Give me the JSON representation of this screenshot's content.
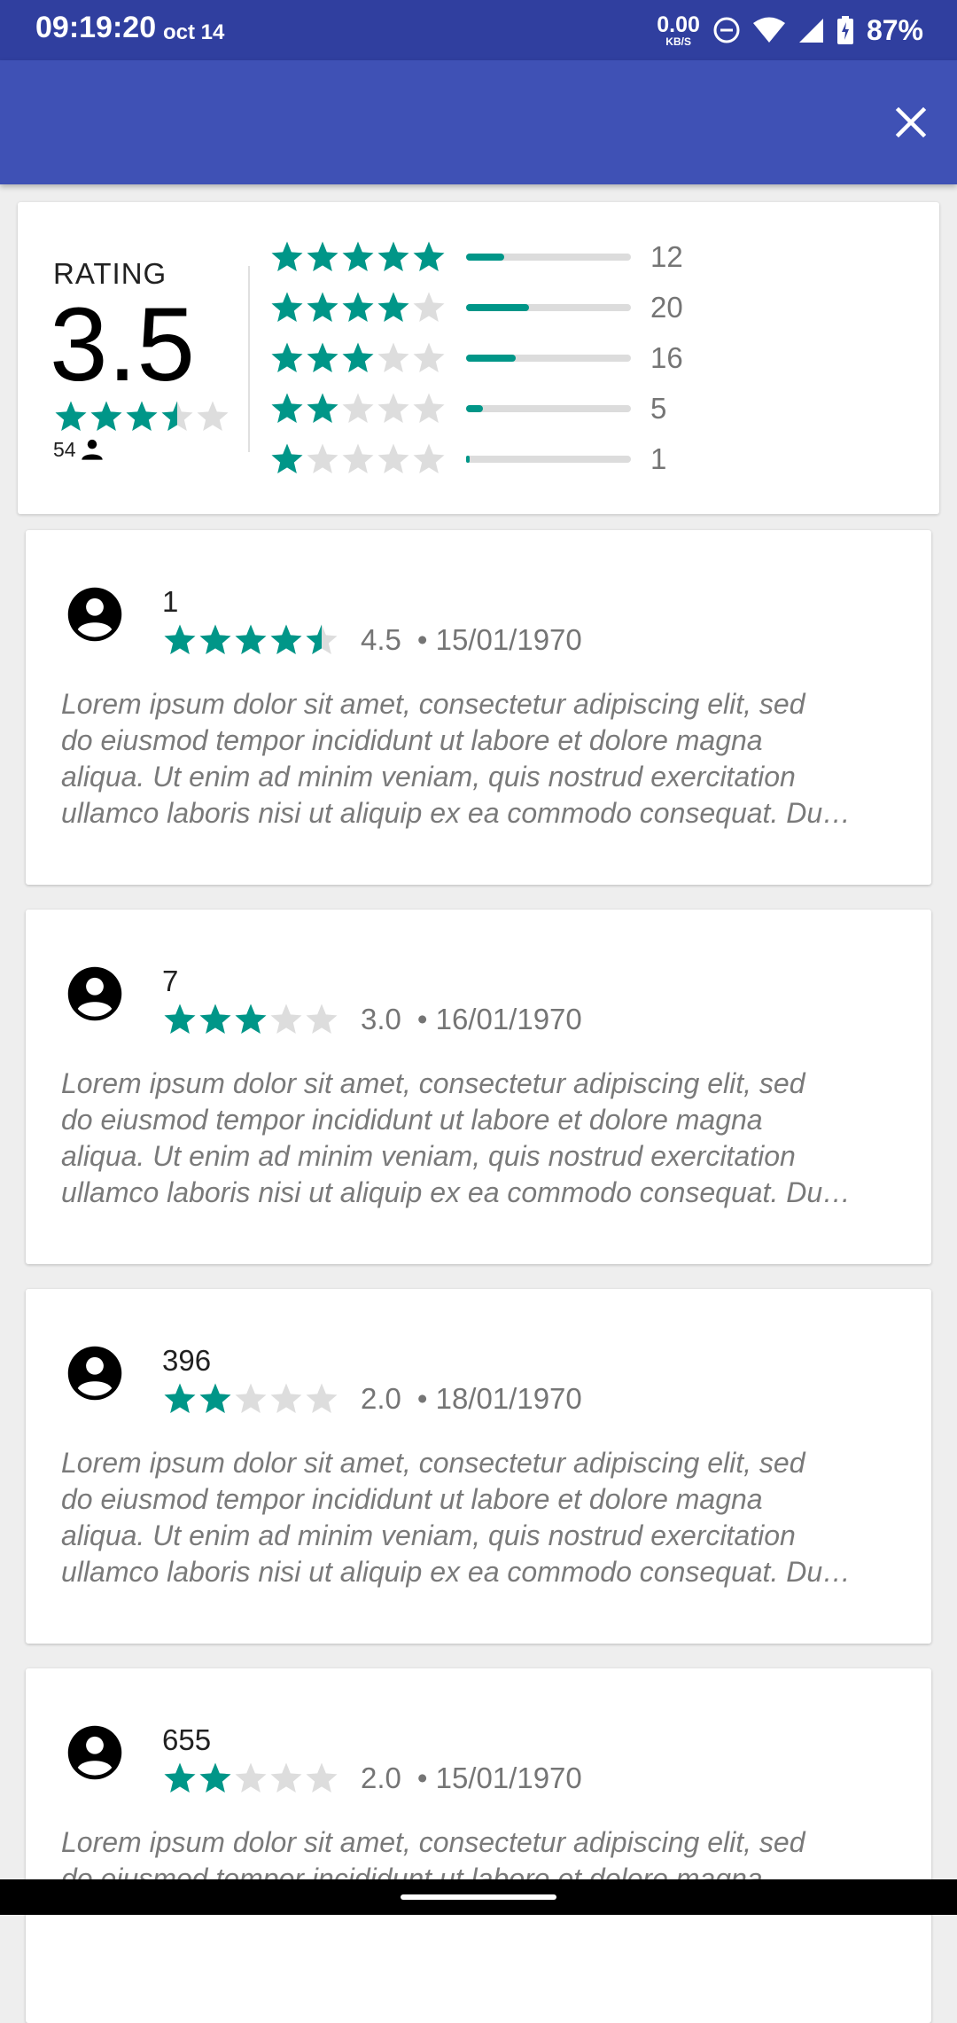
{
  "status_bar": {
    "time": "09:19:20",
    "date": "oct 14",
    "net_speed_value": "0.00",
    "net_speed_unit": "KB/S",
    "battery": "87%"
  },
  "summary": {
    "label": "RATING",
    "average": "3.5",
    "average_stars": 3.5,
    "total_count": "54",
    "distribution": [
      {
        "stars": 5,
        "count": "12",
        "fraction": 0.23
      },
      {
        "stars": 4,
        "count": "20",
        "fraction": 0.38
      },
      {
        "stars": 3,
        "count": "16",
        "fraction": 0.3
      },
      {
        "stars": 2,
        "count": "5",
        "fraction": 0.1
      },
      {
        "stars": 1,
        "count": "1",
        "fraction": 0.02
      }
    ]
  },
  "reviews": [
    {
      "user": "1",
      "stars": 4.5,
      "score": "4.5",
      "date": "• 15/01/1970",
      "lines": [
        "Lorem ipsum dolor sit amet, consectetur adipiscing elit, sed",
        "do eiusmod tempor incididunt ut labore et dolore magna",
        "aliqua. Ut enim ad minim veniam, quis nostrud exercitation",
        "ullamco laboris nisi ut aliquip ex ea commodo consequat. Du…"
      ]
    },
    {
      "user": "7",
      "stars": 3,
      "score": "3.0",
      "date": "• 16/01/1970",
      "lines": [
        "Lorem ipsum dolor sit amet, consectetur adipiscing elit, sed",
        "do eiusmod tempor incididunt ut labore et dolore magna",
        "aliqua. Ut enim ad minim veniam, quis nostrud exercitation",
        "ullamco laboris nisi ut aliquip ex ea commodo consequat. Du…"
      ]
    },
    {
      "user": "396",
      "stars": 2,
      "score": "2.0",
      "date": "• 18/01/1970",
      "lines": [
        "Lorem ipsum dolor sit amet, consectetur adipiscing elit, sed",
        "do eiusmod tempor incididunt ut labore et dolore magna",
        "aliqua. Ut enim ad minim veniam, quis nostrud exercitation",
        "ullamco laboris nisi ut aliquip ex ea commodo consequat. Du…"
      ]
    },
    {
      "user": "655",
      "stars": 2,
      "score": "2.0",
      "date": "• 15/01/1970",
      "lines": [
        "Lorem ipsum dolor sit amet, consectetur adipiscing elit, sed",
        "do eiusmod tempor incididunt ut labore et dolore magna"
      ]
    }
  ],
  "colors": {
    "status_bar": "#303f9f",
    "app_bar": "#3f51b5",
    "star_filled": "#009688",
    "star_empty": "#dddddd"
  },
  "icons": {
    "close": "close-icon",
    "avatar": "account-circle-icon",
    "person": "person-icon"
  }
}
